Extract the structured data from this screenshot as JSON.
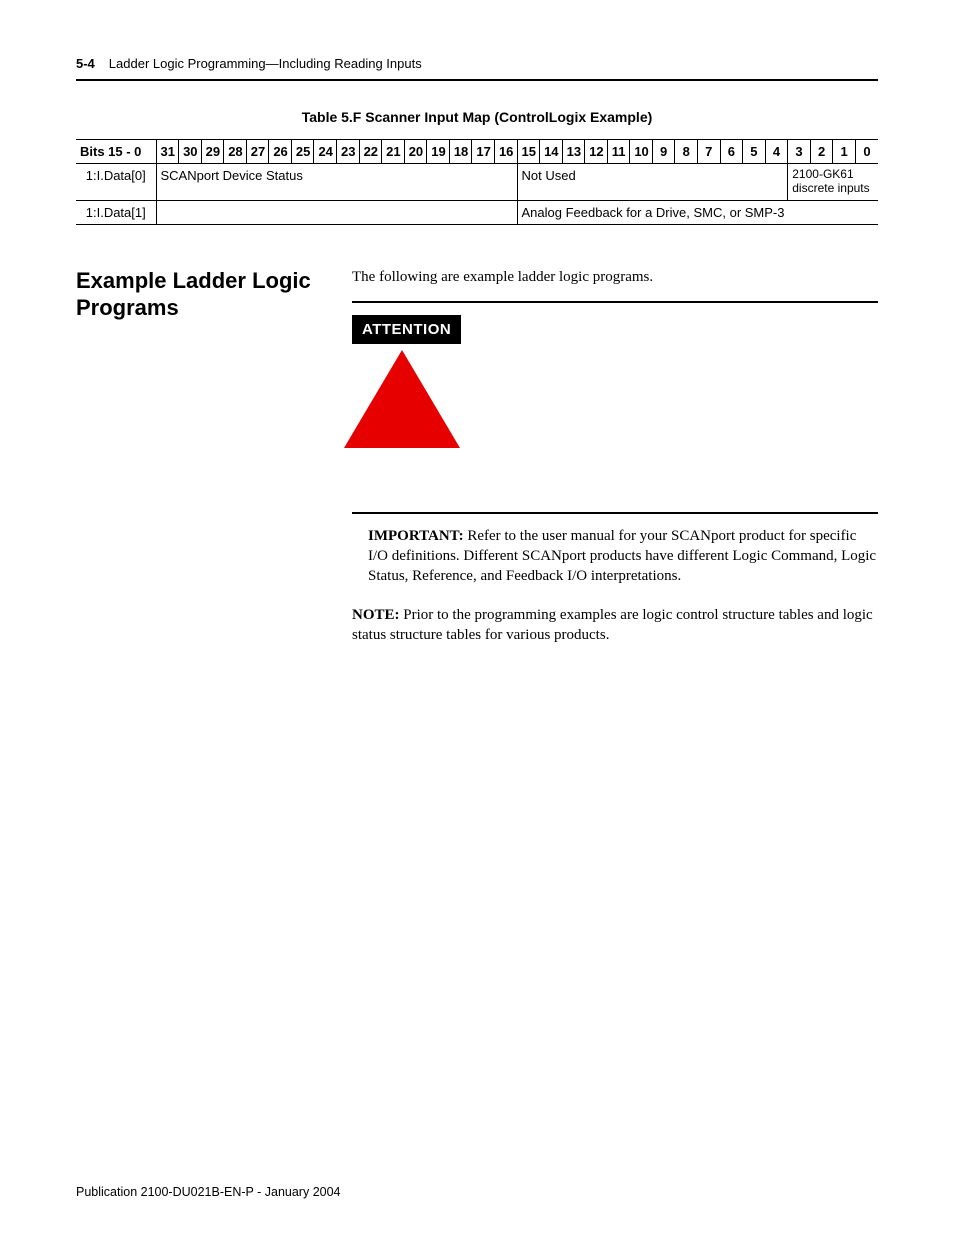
{
  "header": {
    "page_num": "5-4",
    "title": "Ladder Logic Programming—Including Reading Inputs"
  },
  "table": {
    "caption": "Table 5.F Scanner Input Map (ControlLogix Example)",
    "row_header_label": "Bits 15 - 0",
    "bit_cols": [
      "31",
      "30",
      "29",
      "28",
      "27",
      "26",
      "25",
      "24",
      "23",
      "22",
      "21",
      "20",
      "19",
      "18",
      "17",
      "16",
      "15",
      "14",
      "13",
      "12",
      "11",
      "10",
      "9",
      "8",
      "7",
      "6",
      "5",
      "4",
      "3",
      "2",
      "1",
      "0"
    ],
    "rows": [
      {
        "name": "1:I.Data[0]",
        "cells": [
          {
            "span": 16,
            "text": "SCANport Device Status"
          },
          {
            "span": 12,
            "text": "Not Used"
          },
          {
            "span": 4,
            "text": "2100-GK61 discrete inputs",
            "small": true
          }
        ]
      },
      {
        "name": "1:I.Data[1]",
        "cells": [
          {
            "span": 16,
            "text": ""
          },
          {
            "span": 16,
            "text": "Analog Feedback for a Drive, SMC, or SMP-3"
          }
        ]
      }
    ]
  },
  "section": {
    "heading": "Example Ladder Logic Programs",
    "intro": "The following are example ladder logic programs.",
    "attention_label": "ATTENTION",
    "important_label": "IMPORTANT:",
    "important_text": "Refer to the user manual for your SCANport product for specific I/O definitions. Different SCANport products have different Logic Command, Logic Status, Reference, and Feedback I/O interpretations.",
    "note_label": "NOTE:",
    "note_text": "Prior to the programming examples are logic control structure tables and logic status structure tables for various products."
  },
  "footer": "Publication 2100-DU021B-EN-P - January 2004"
}
